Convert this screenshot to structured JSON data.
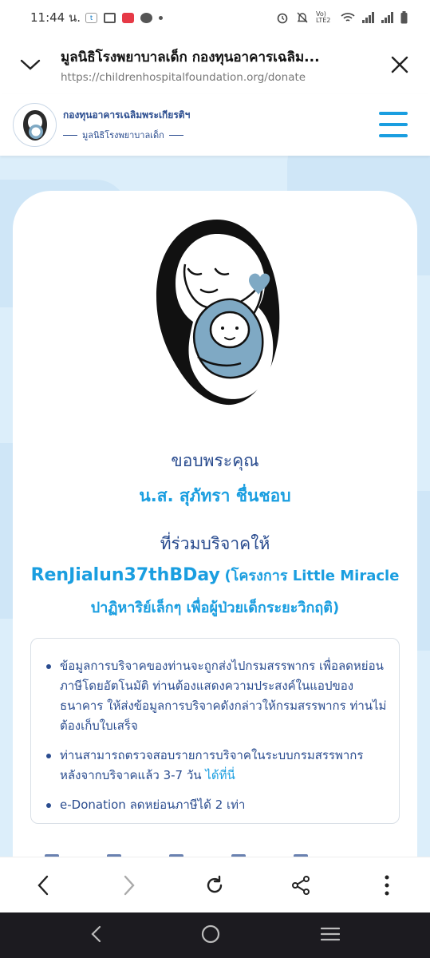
{
  "status_bar": {
    "time": "11:44 น.",
    "apps": [
      "tab-app-icon",
      "gmail-icon",
      "red-app-icon",
      "line-icon"
    ],
    "net_label": "Vo) LTE2"
  },
  "browser": {
    "tab_title": "มูลนิธิโรงพยาบาลเด็ก กองทุนอาคารเฉลิม...",
    "url": "https://childrenhospitalfoundation.org/donate"
  },
  "site": {
    "logo_main": "กองทุนอาคารเฉลิมพระเกียรติฯ",
    "logo_sub": "มูลนิธิโรงพยาบาลเด็ก"
  },
  "thanks": {
    "heading": "ขอบพระคุณ",
    "donor": "น.ส. สุภัทรา ชื่นชอบ",
    "joined": "ที่ร่วมบริจาคให้",
    "project_main": "RenJialun37thBDay",
    "project_rest": "(โครงการ Little Miracle ปาฏิหาริย์เล็กๆ เพื่อผู้ป่วยเด็กระยะวิกฤติ)"
  },
  "info": {
    "item1": "ข้อมูลการบริจาคของท่านจะถูกส่งไปกรมสรรพากร เพื่อลดหย่อนภาษีโดยอัตโนมัติ ท่านต้องแสดงความประสงค์ในแอปของธนาคาร ให้ส่งข้อมูลการบริจาคดังกล่าวให้กรมสรรพากร ท่านไม่ต้องเก็บใบเสร็จ",
    "item2_text": "ท่านสามารถตรวจสอบรายการบริจาคในระบบกรมสรรพากร หลังจากบริจาคแล้ว 3-7 วัน",
    "item2_link": "ได้ที่นี่",
    "item3": "e-Donation ลดหย่อนภาษีได้ 2 เท่า"
  },
  "colors": {
    "accent": "#1a9ee0",
    "navy": "#2a4c8f",
    "page_bg": "#dceefa",
    "illustration_blue": "#7fa9c4"
  }
}
